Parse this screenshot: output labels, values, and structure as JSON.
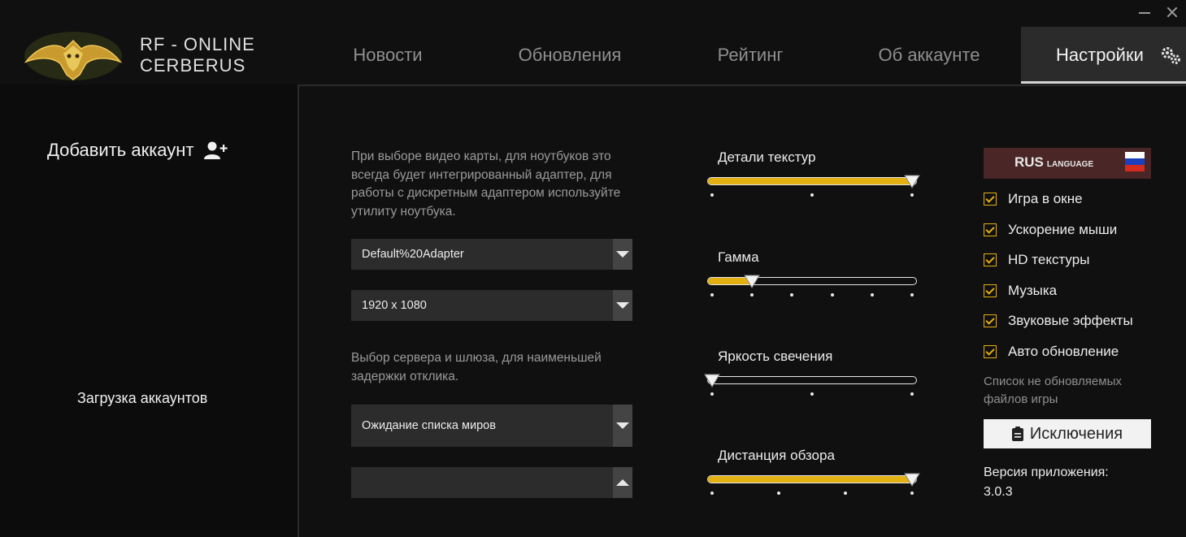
{
  "window": {
    "minimize_icon": "minimize-icon",
    "close_icon": "close-icon"
  },
  "logo": {
    "line1": "RF - ONLINE",
    "line2": "CERBERUS"
  },
  "nav": {
    "tabs": [
      {
        "label": "Новости"
      },
      {
        "label": "Обновления"
      },
      {
        "label": "Рейтинг"
      },
      {
        "label": "Об аккаунте"
      },
      {
        "label": "Настройки",
        "active": true
      }
    ],
    "settings_icon": "gears-icon"
  },
  "sidebar": {
    "add_account": "Добавить аккаунт",
    "loading_accounts": "Загрузка аккаунтов"
  },
  "settings": {
    "gpu_hint": "При выборе видео карты, для ноутбуков это всегда будет интегрированный адаптер, для работы с дискретным адаптером используйте утилиту ноутбука.",
    "gpu_select": "Default%20Adapter",
    "resolution_select": "1920 x 1080",
    "server_hint": "Выбор сервера и шлюза, для наименьшей задержки отклика.",
    "world_select": "Ожидание списка миров",
    "gateway_select": ""
  },
  "sliders": [
    {
      "label": "Детали текстур",
      "steps": 3,
      "value_index": 2
    },
    {
      "label": "Гамма",
      "steps": 6,
      "value_index": 1
    },
    {
      "label": "Яркость свечения",
      "steps": 3,
      "value_index": 0
    },
    {
      "label": "Дистанция обзора",
      "steps": 4,
      "value_index": 3
    }
  ],
  "language": {
    "code": "RUS",
    "word": "LANGUAGE"
  },
  "options": [
    {
      "label": "Игра в окне",
      "checked": true
    },
    {
      "label": "Ускорение мыши",
      "checked": true
    },
    {
      "label": "HD текстуры",
      "checked": true
    },
    {
      "label": "Музыка",
      "checked": true
    },
    {
      "label": "Звуковые эффекты",
      "checked": true
    },
    {
      "label": "Авто обновление",
      "checked": true
    }
  ],
  "exclusions_note": "Список не обновляемых файлов игры",
  "exclusions_button": "Исключения",
  "version_label": "Версия приложения:",
  "version_value": "3.0.3",
  "colors": {
    "accent": "#e2b010",
    "panel": "#2c2c2c",
    "background": "#101010"
  }
}
